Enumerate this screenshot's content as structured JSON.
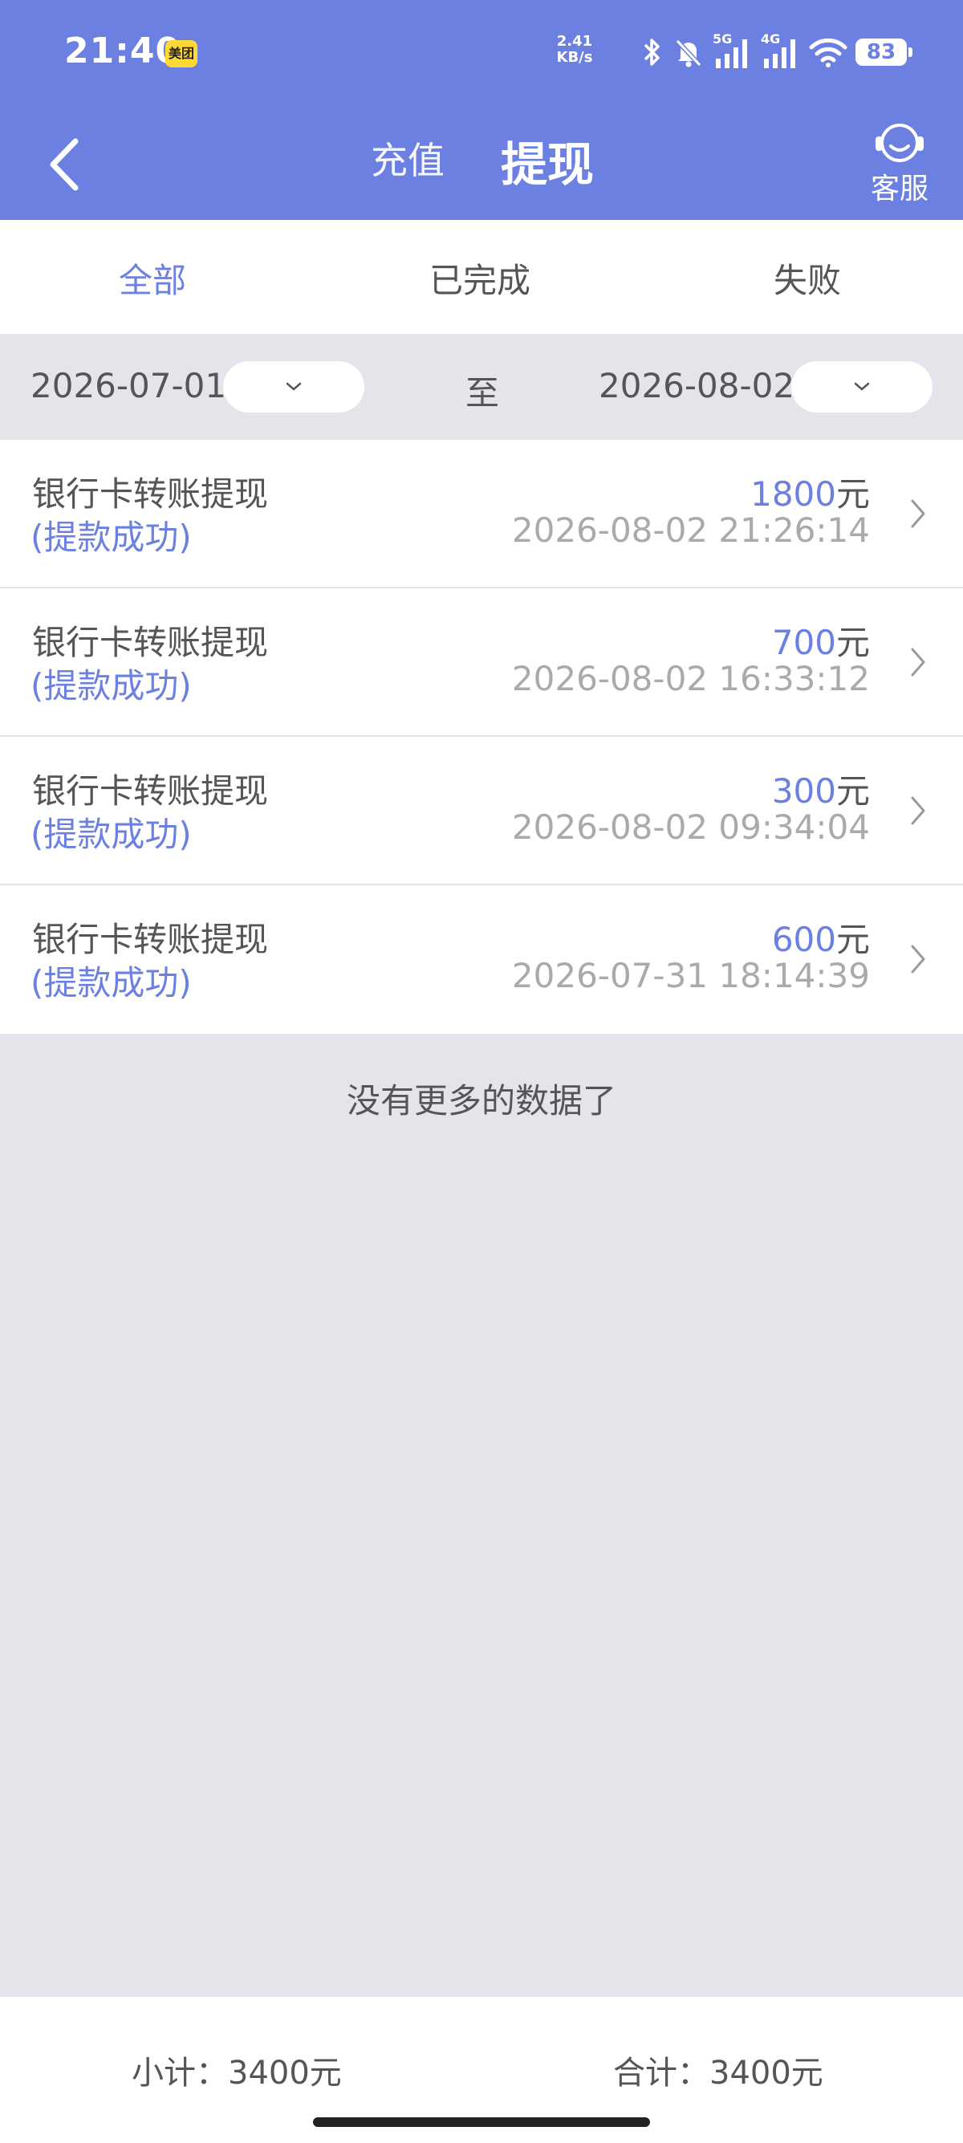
{
  "status_bar": {
    "time": "21:40",
    "app_badge": "美团",
    "net_speed_value": "2.41",
    "net_speed_unit": "KB/s",
    "signal_1_label": "5G",
    "signal_2_label": "4G",
    "battery": "83"
  },
  "header": {
    "tab_recharge": "充值",
    "tab_withdraw": "提现",
    "service_label": "客服"
  },
  "filters": {
    "all": "全部",
    "completed": "已完成",
    "failed": "失败",
    "active": "all"
  },
  "date_range": {
    "start": "2026-07-01",
    "separator": "至",
    "end": "2026-08-02"
  },
  "records": [
    {
      "title": "银行卡转账提现",
      "status": "(提款成功)",
      "amount": "1800",
      "unit": "元",
      "time": "2026-08-02 21:26:14"
    },
    {
      "title": "银行卡转账提现",
      "status": "(提款成功)",
      "amount": "700",
      "unit": "元",
      "time": "2026-08-02 16:33:12"
    },
    {
      "title": "银行卡转账提现",
      "status": "(提款成功)",
      "amount": "300",
      "unit": "元",
      "time": "2026-08-02 09:34:04"
    },
    {
      "title": "银行卡转账提现",
      "status": "(提款成功)",
      "amount": "600",
      "unit": "元",
      "time": "2026-07-31 18:14:39"
    }
  ],
  "no_more": "没有更多的数据了",
  "footer": {
    "subtotal": "小计：3400元",
    "total": "合计：3400元"
  },
  "colors": {
    "accent": "#6b80e0",
    "background": "#e4e5ea"
  }
}
